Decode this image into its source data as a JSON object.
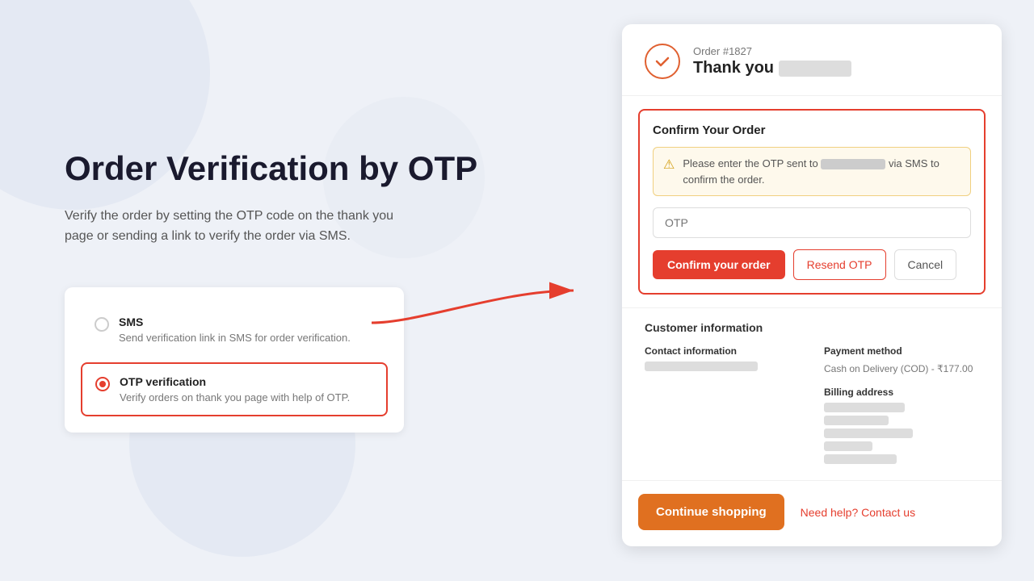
{
  "background": {
    "color": "#eef1f7"
  },
  "left": {
    "heading": "Order Verification by OTP",
    "description": "Verify the order by setting the OTP code on the thank you page or sending a link to verify the order via SMS.",
    "options": [
      {
        "id": "sms",
        "label": "SMS",
        "description": "Send verification link in SMS for order verification.",
        "selected": false
      },
      {
        "id": "otp",
        "label": "OTP verification",
        "description": "Verify orders on thank you page with help of OTP.",
        "selected": true
      }
    ]
  },
  "right": {
    "order_number": "Order #1827",
    "thank_you_prefix": "Thank you",
    "confirm_section": {
      "title": "Confirm Your Order",
      "alert_prefix": "Please enter the OTP sent to",
      "alert_suffix": "via SMS to confirm the order.",
      "otp_placeholder": "OTP",
      "confirm_btn": "Confirm your order",
      "resend_btn": "Resend OTP",
      "cancel_btn": "Cancel"
    },
    "customer_section": {
      "title": "Customer information",
      "contact_label": "Contact information",
      "payment_label": "Payment method",
      "payment_value": "Cash on Delivery (COD) - ₹177.00",
      "billing_label": "Billing address"
    },
    "continue_btn": "Continue shopping",
    "need_help": "Need help? Contact us"
  }
}
